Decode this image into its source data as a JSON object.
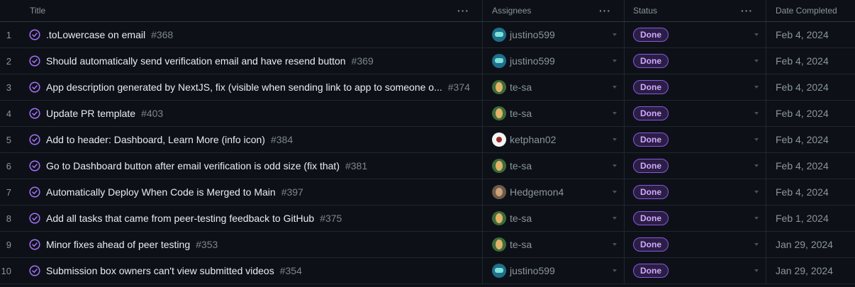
{
  "header": {
    "title": "Title",
    "assignees": "Assignees",
    "status": "Status",
    "date_completed": "Date Completed",
    "menu_glyph": "···"
  },
  "rows": [
    {
      "num": "1",
      "title": ".toLowercase on email",
      "issue": "#368",
      "assignee": "justino599",
      "avatar": "av-justino",
      "status": "Done",
      "date": "Feb 4, 2024"
    },
    {
      "num": "2",
      "title": "Should automatically send verification email and have resend button",
      "issue": "#369",
      "assignee": "justino599",
      "avatar": "av-justino",
      "status": "Done",
      "date": "Feb 4, 2024"
    },
    {
      "num": "3",
      "title": "App description generated by NextJS, fix (visible when sending link to app to someone o...",
      "issue": "#374",
      "assignee": "te-sa",
      "avatar": "av-tesa",
      "status": "Done",
      "date": "Feb 4, 2024"
    },
    {
      "num": "4",
      "title": "Update PR template",
      "issue": "#403",
      "assignee": "te-sa",
      "avatar": "av-tesa",
      "status": "Done",
      "date": "Feb 4, 2024"
    },
    {
      "num": "5",
      "title": "Add to header: Dashboard, Learn More (info icon)",
      "issue": "#384",
      "assignee": "ketphan02",
      "avatar": "av-ketphan",
      "status": "Done",
      "date": "Feb 4, 2024"
    },
    {
      "num": "6",
      "title": "Go to Dashboard button after email verification is odd size (fix that)",
      "issue": "#381",
      "assignee": "te-sa",
      "avatar": "av-tesa",
      "status": "Done",
      "date": "Feb 4, 2024"
    },
    {
      "num": "7",
      "title": "Automatically Deploy When Code is Merged to Main",
      "issue": "#397",
      "assignee": "Hedgemon4",
      "avatar": "av-hedge",
      "status": "Done",
      "date": "Feb 4, 2024"
    },
    {
      "num": "8",
      "title": "Add all tasks that came from peer-testing feedback to GitHub",
      "issue": "#375",
      "assignee": "te-sa",
      "avatar": "av-tesa",
      "status": "Done",
      "date": "Feb 1, 2024"
    },
    {
      "num": "9",
      "title": "Minor fixes ahead of peer testing",
      "issue": "#353",
      "assignee": "te-sa",
      "avatar": "av-tesa",
      "status": "Done",
      "date": "Jan 29, 2024"
    },
    {
      "num": "10",
      "title": "Submission box owners can't view submitted videos",
      "issue": "#354",
      "assignee": "justino599",
      "avatar": "av-justino",
      "status": "Done",
      "date": "Jan 29, 2024"
    }
  ],
  "colors": {
    "done_icon": "#a371f7",
    "badge_border": "#8957e5",
    "badge_text": "#d2a8ff"
  },
  "icons": {
    "issue": "issue-closed-icon",
    "caret": "chevron-down-icon"
  }
}
